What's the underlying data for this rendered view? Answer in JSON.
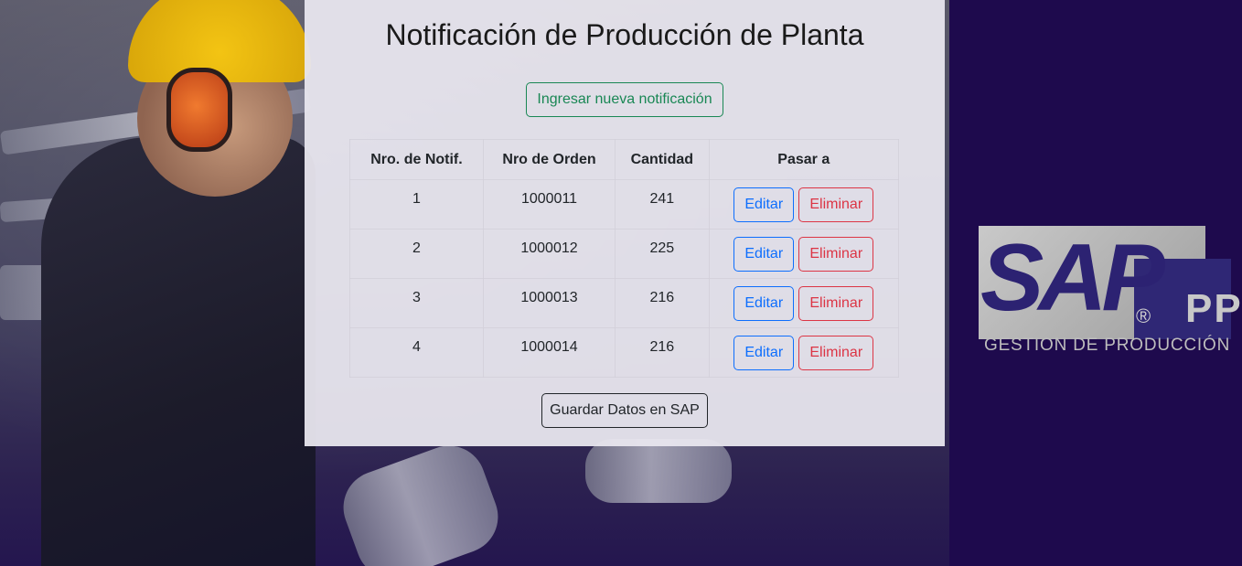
{
  "page": {
    "title": "Notificación de Producción de Planta"
  },
  "actions": {
    "new_label": "Ingresar nueva notificación",
    "save_label": "Guardar Datos en SAP"
  },
  "table": {
    "headers": [
      "Nro. de Notif.",
      "Nro de Orden",
      "Cantidad",
      "Pasar a"
    ],
    "rows": [
      {
        "notif": "1",
        "orden": "1000011",
        "cantidad": "241",
        "edit": "Editar",
        "delete": "Eliminar"
      },
      {
        "notif": "2",
        "orden": "1000012",
        "cantidad": "225",
        "edit": "Editar",
        "delete": "Eliminar"
      },
      {
        "notif": "3",
        "orden": "1000013",
        "cantidad": "216",
        "edit": "Editar",
        "delete": "Eliminar"
      },
      {
        "notif": "4",
        "orden": "1000014",
        "cantidad": "216",
        "edit": "Editar",
        "delete": "Eliminar"
      }
    ]
  },
  "logo": {
    "brand": "SAP",
    "registered": "®",
    "module": "PP",
    "subtitle": "GESTION DE PRODUCCIÓN"
  },
  "colors": {
    "success": "#198754",
    "primary": "#0d6efd",
    "danger": "#dc3545",
    "dark": "#212529",
    "sidebar_bg": "#1e0a4d"
  }
}
